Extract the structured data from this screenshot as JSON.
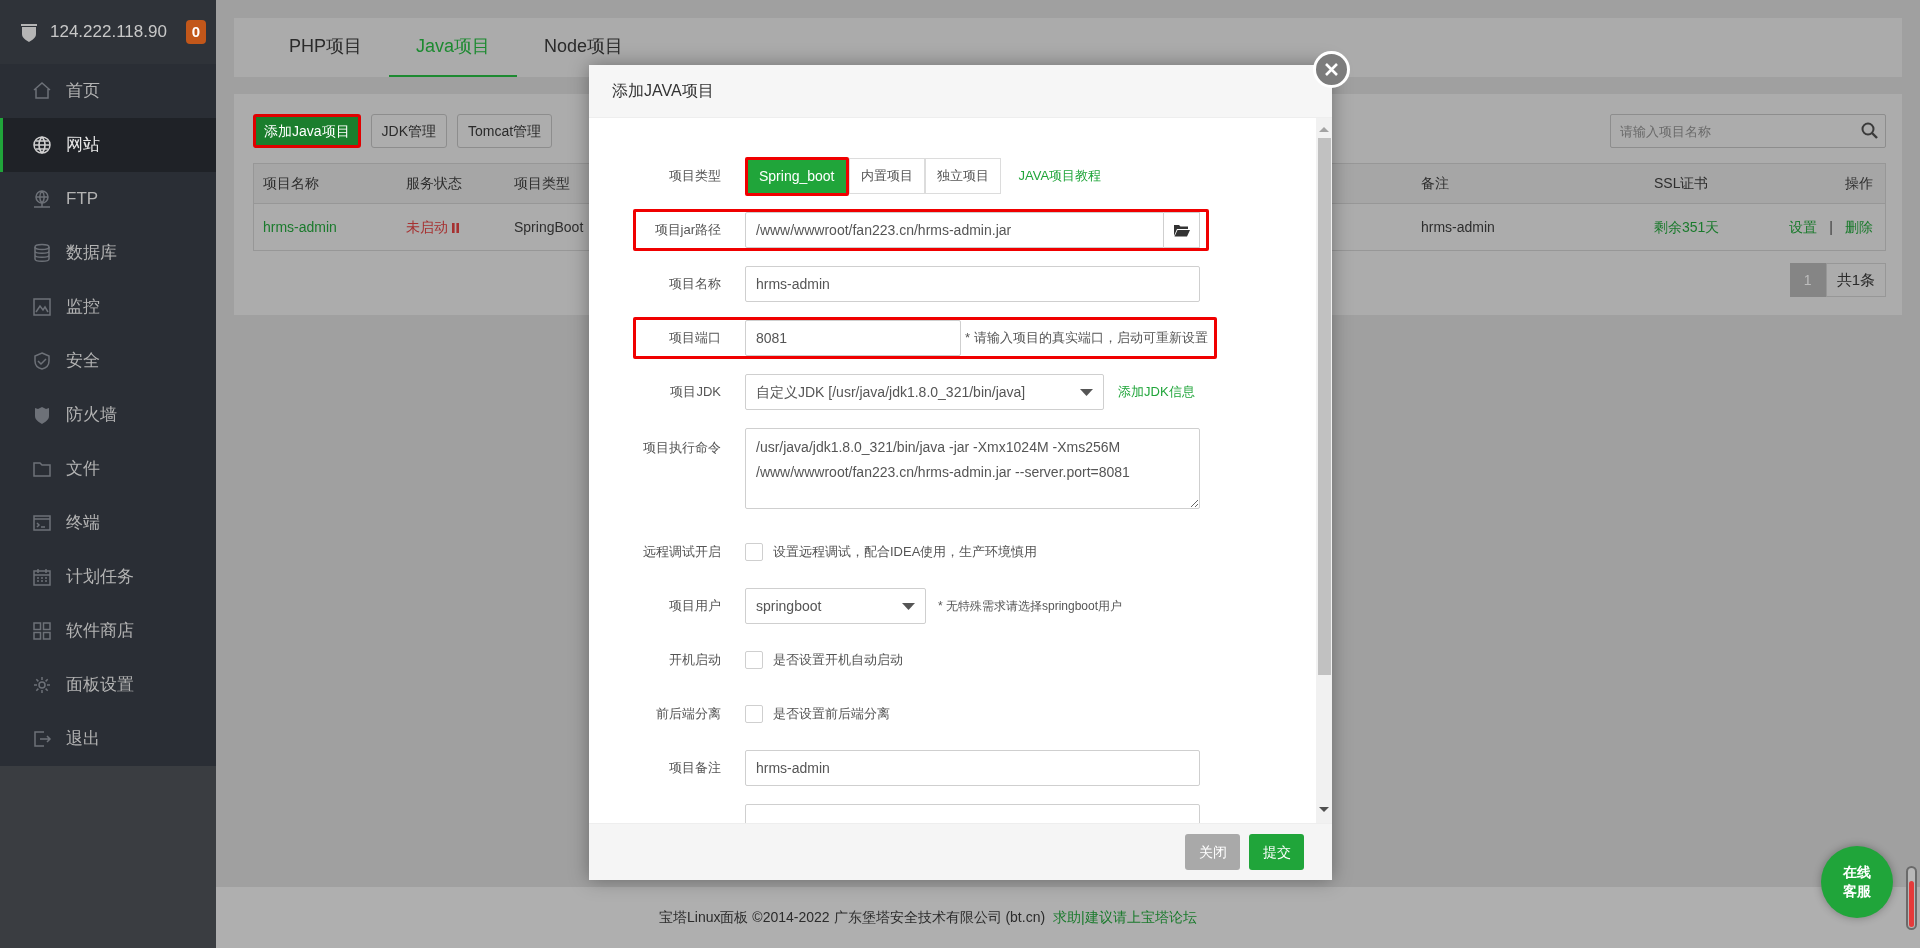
{
  "sidebar": {
    "host": "124.222.118.90",
    "badge": "0",
    "items": [
      {
        "label": "首页",
        "selected": false
      },
      {
        "label": "网站",
        "selected": true
      },
      {
        "label": "FTP",
        "selected": false
      },
      {
        "label": "数据库",
        "selected": false
      },
      {
        "label": "监控",
        "selected": false
      },
      {
        "label": "安全",
        "selected": false
      },
      {
        "label": "防火墙",
        "selected": false
      },
      {
        "label": "文件",
        "selected": false
      },
      {
        "label": "终端",
        "selected": false
      },
      {
        "label": "计划任务",
        "selected": false
      },
      {
        "label": "软件商店",
        "selected": false
      },
      {
        "label": "面板设置",
        "selected": false
      },
      {
        "label": "退出",
        "selected": false
      }
    ]
  },
  "tabs": [
    {
      "label": "PHP项目",
      "selected": false
    },
    {
      "label": "Java项目",
      "selected": true
    },
    {
      "label": "Node项目",
      "selected": false
    }
  ],
  "toolbar": {
    "buttons": [
      {
        "label": "添加Java项目",
        "kind": "primary",
        "highlighted": true
      },
      {
        "label": "JDK管理",
        "kind": "default",
        "highlighted": false
      },
      {
        "label": "Tomcat管理",
        "kind": "default",
        "highlighted": false
      }
    ],
    "search": {
      "placeholder": "请输入项目名称"
    }
  },
  "table": {
    "columns": [
      "项目名称",
      "服务状态",
      "项目类型",
      "备注",
      "SSL证书",
      "操作"
    ],
    "rows": [
      {
        "name": "hrms-admin",
        "status": "未启动",
        "running": false,
        "type": "SpringBoot",
        "note": "hrms-admin",
        "ssl": "剩余351天",
        "actions": [
          "设置",
          "删除"
        ],
        "separator": "|"
      }
    ]
  },
  "pagination": {
    "pages": [
      {
        "label": "1",
        "selected": true
      }
    ],
    "total": "共1条"
  },
  "dialog": {
    "title": "添加JAVA项目",
    "fields": [
      {
        "kind": "segmented",
        "label": "项目类型",
        "options": [
          {
            "label": "Spring_boot",
            "selected": true,
            "highlighted": true
          },
          {
            "label": "内置项目",
            "selected": false,
            "highlighted": false
          },
          {
            "label": "独立项目",
            "selected": false,
            "highlighted": false
          }
        ],
        "link": "JAVA项目教程"
      },
      {
        "kind": "file",
        "label": "项目jar路径",
        "value": "/www/wwwroot/fan223.cn/hrms-admin.jar",
        "highlighted": true
      },
      {
        "kind": "text",
        "label": "项目名称",
        "value": "hrms-admin",
        "highlighted": false
      },
      {
        "kind": "text",
        "label": "项目端口",
        "value": "8081",
        "hint": "* 请输入项目的真实端口，启动可重新设置",
        "highlighted": true
      },
      {
        "kind": "select",
        "label": "项目JDK",
        "value": "自定义JDK [/usr/java/jdk1.8.0_321/bin/java]",
        "link": "添加JDK信息",
        "highlighted": false
      },
      {
        "kind": "textarea",
        "label": "项目执行命令",
        "value": "/usr/java/jdk1.8.0_321/bin/java -jar -Xmx1024M -Xms256M /www/wwwroot/fan223.cn/hrms-admin.jar --server.port=8081",
        "highlighted": false
      },
      {
        "kind": "checkbox",
        "label": "远程调试开启",
        "text": "设置远程调试，配合IDEA使用，生产环境慎用",
        "checked": false,
        "highlighted": false
      },
      {
        "kind": "select",
        "label": "项目用户",
        "value": "springboot",
        "hint": "* 无特殊需求请选择springboot用户",
        "highlighted": false
      },
      {
        "kind": "checkbox",
        "label": "开机启动",
        "text": "是否设置开机自动启动",
        "checked": false,
        "highlighted": false
      },
      {
        "kind": "checkbox",
        "label": "前后端分离",
        "text": "是否设置前后端分离",
        "checked": false,
        "highlighted": false
      },
      {
        "kind": "text",
        "label": "项目备注",
        "value": "hrms-admin",
        "highlighted": false
      },
      {
        "kind": "text",
        "highlighted": false
      }
    ],
    "buttons": [
      {
        "label": "关闭",
        "kind": "disabled"
      },
      {
        "label": "提交",
        "kind": "primary"
      }
    ]
  },
  "footer": {
    "text": "宝塔Linux面板 ©2014-2022 广东堡塔安全技术有限公司 (bt.cn)",
    "link": "求助|建议请上宝塔论坛"
  },
  "chat": {
    "label": "在线客服"
  }
}
